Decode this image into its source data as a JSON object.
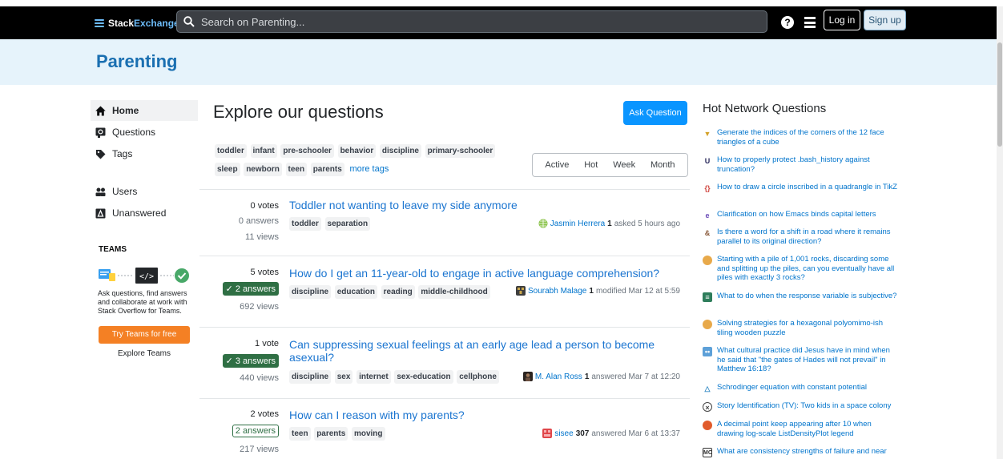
{
  "topbar": {
    "logo_stack": "Stack",
    "logo_exchange": "Exchange",
    "search_placeholder": "Search on Parenting...",
    "help_glyph": "?",
    "login_label": "Log in",
    "signup_label": "Sign up"
  },
  "site": {
    "name": "Parenting"
  },
  "nav": {
    "home": "Home",
    "questions": "Questions",
    "tags": "Tags",
    "users": "Users",
    "unanswered": "Unanswered",
    "teams_label": "TEAMS",
    "teams_text": "Ask questions, find answers and collaborate at work with Stack Overflow for Teams.",
    "teams_button": "Try Teams for free",
    "explore_teams": "Explore Teams"
  },
  "main": {
    "title": "Explore our questions",
    "ask_button": "Ask Question",
    "tags": [
      "toddler",
      "infant",
      "pre-schooler",
      "behavior",
      "discipline",
      "primary-schooler",
      "sleep",
      "newborn",
      "teen",
      "parents"
    ],
    "more_tags": "more tags",
    "filters": [
      "Active",
      "Hot",
      "Week",
      "Month"
    ]
  },
  "questions": [
    {
      "votes": "0 votes",
      "answers": "0 answers",
      "views": "11 views",
      "title": "Toddler not wanting to leave my side anymore",
      "tags": [
        "toddler",
        "separation"
      ],
      "user": "Jasmin Herrera",
      "rep": "1",
      "action": "asked 5 hours ago"
    },
    {
      "votes": "5 votes",
      "answers": "2 answers",
      "views": "692 views",
      "title": "How do I get an 11-year-old to engage in active language comprehension?",
      "tags": [
        "discipline",
        "education",
        "reading",
        "middle-childhood"
      ],
      "user": "Sourabh Malage",
      "rep": "1",
      "action": "modified Mar 12 at 5:59"
    },
    {
      "votes": "1 vote",
      "answers": "3 answers",
      "views": "440 views",
      "title": "Can suppressing sexual feelings at an early age lead a person to become asexual?",
      "tags": [
        "discipline",
        "sex",
        "internet",
        "sex-education",
        "cellphone"
      ],
      "user": "M. Alan Ross",
      "rep": "1",
      "action": "answered Mar 7 at 12:20"
    },
    {
      "votes": "2 votes",
      "answers": "2 answers",
      "views": "217 views",
      "title": "How can I reason with my parents?",
      "tags": [
        "teen",
        "parents",
        "moving"
      ],
      "user": "sisee",
      "rep": "307",
      "action": "answered Mar 6 at 13:37"
    }
  ],
  "hnq": {
    "title": "Hot Network Questions",
    "items": [
      {
        "icon": "codegolf-icon",
        "text": "Generate the indices of the corners of the 12 face triangles of a cube"
      },
      {
        "icon": "unix-icon",
        "text": "How to properly protect .bash_history against truncation?"
      },
      {
        "icon": "tex-icon",
        "text": "How to draw a circle inscribed in a quadrangle in TikZ"
      },
      {
        "icon": "emacs-icon",
        "text": "Clarification on how Emacs binds capital letters"
      },
      {
        "icon": "english-icon",
        "text": "Is there a word for a shift in a road where it remains parallel to its original direction?"
      },
      {
        "icon": "puzzling-icon",
        "text": "Starting with a pile of 1,001 rocks, discarding some and splitting up the piles, can you eventually have all piles with exactly 3 rocks?"
      },
      {
        "icon": "stats-icon",
        "text": "What to do when the response variable is subjective?"
      },
      {
        "icon": "puzzling-icon",
        "text": "Solving strategies for a hexagonal polyomimo-ish tiling wooden puzzle"
      },
      {
        "icon": "hermeneutics-icon",
        "text": "What cultural practice did Jesus have in mind when he said that \"the gates of Hades will not prevail\" in Matthew 16:18?"
      },
      {
        "icon": "physics-icon",
        "text": "Schrodinger equation with constant potential"
      },
      {
        "icon": "scifi-icon",
        "text": "Story Identification (TV): Two kids in a space colony"
      },
      {
        "icon": "mathematica-icon",
        "text": "A decimal point keep appearing after 10 when drawing log-scale ListDensityPlot legend"
      },
      {
        "icon": "mo-icon",
        "text": "What are consistency strengths of failure and near"
      }
    ]
  }
}
